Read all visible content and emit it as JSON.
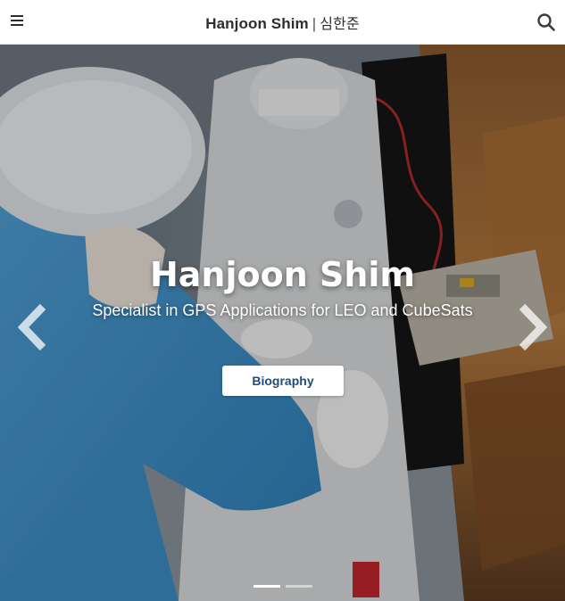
{
  "header": {
    "title_name": "Hanjoon Shim",
    "title_separator": "|",
    "title_korean": "심한준",
    "menu_icon": "hamburger-menu-icon",
    "search_icon": "search-icon"
  },
  "hero": {
    "title": "Hanjoon Shim",
    "subtitle": "Specialist in GPS Applications for LEO and CubeSats",
    "button_label": "Biography",
    "prev_icon": "chevron-left-icon",
    "next_icon": "chevron-right-icon",
    "slide_count": 2,
    "active_slide": 1
  },
  "colors": {
    "button_text": "#1f4c7a",
    "header_bg": "#ffffff",
    "title_text": "#2d2d2d"
  }
}
